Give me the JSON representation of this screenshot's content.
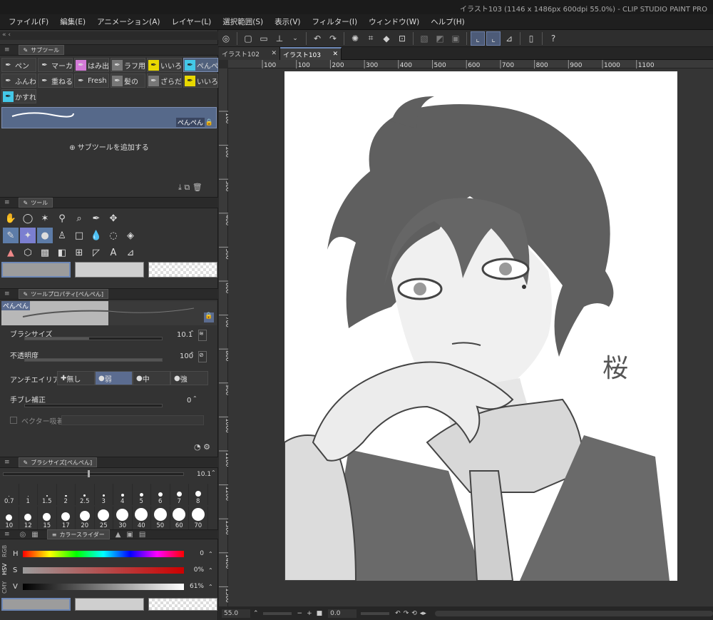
{
  "window": {
    "title": "イラスト103 (1146 x 1486px 600dpi 55.0%) - CLIP STUDIO PAINT PRO"
  },
  "menu": [
    "ファイル(F)",
    "編集(E)",
    "アニメーション(A)",
    "レイヤー(L)",
    "選択範囲(S)",
    "表示(V)",
    "フィルター(I)",
    "ウィンドウ(W)",
    "ヘルプ(H)"
  ],
  "subtool_panel": {
    "title": "サブツール",
    "row1": [
      "ペン",
      "マーカ",
      "はみ出",
      "ラフ用",
      "いいろ",
      "ぺんぺ"
    ],
    "row2": [
      "ふんわ",
      "重ねる",
      "Fresh",
      "髪の",
      "ざらだ",
      "いいろ"
    ],
    "row3": [
      "かすれ"
    ],
    "selected_brush": "ぺんぺん",
    "add_subtool": "サブツールを追加する"
  },
  "tool_panel": {
    "title": "ツール"
  },
  "tool_property": {
    "title": "ツールプロパティ[ぺんぺん]",
    "brush_name": "ぺんぺん",
    "brush_size_label": "ブラシサイズ",
    "brush_size_value": "10.1",
    "opacity_label": "不透明度",
    "opacity_value": "100",
    "antialias_label": "アンチエイリアス",
    "antialias_options": [
      "無し",
      "弱",
      "中",
      "強"
    ],
    "antialias_selected": "弱",
    "stabilization_label": "手ブレ補正",
    "stabilization_value": "0",
    "vector_snap_label": "ベクター吸着"
  },
  "brush_size_panel": {
    "title": "ブラシサイズ[ぺんぺん]",
    "value": "10.1",
    "sizes_row1": [
      "0.7",
      "1",
      "1.5",
      "2",
      "2.5",
      "3",
      "4",
      "5",
      "6",
      "7",
      "8"
    ],
    "sizes_row2": [
      "10",
      "12",
      "15",
      "17",
      "20",
      "25",
      "30",
      "40",
      "50",
      "60",
      "70"
    ]
  },
  "color_slider": {
    "title": "カラースライダー",
    "mode_tabs": [
      "RGB",
      "HSV",
      "CMY"
    ],
    "h_label": "H",
    "h_value": "0",
    "s_label": "S",
    "s_value": "0%",
    "v_label": "V",
    "v_value": "61%"
  },
  "canvas": {
    "tabs": [
      "イラスト102",
      "イラスト103"
    ],
    "active_tab": "イラスト103",
    "ruler_h": [
      "100",
      "100",
      "200",
      "300",
      "400",
      "500",
      "600",
      "700",
      "800",
      "900",
      "1000",
      "1100"
    ],
    "ruler_v": [
      "100",
      "200",
      "300",
      "400",
      "500",
      "600",
      "700",
      "800",
      "900",
      "1000",
      "1100",
      "1200",
      "1300",
      "1400",
      "1500"
    ],
    "zoom": "55.0",
    "rotation": "0.0",
    "signature": "桜"
  },
  "colors": {
    "accent": "#6d87b5",
    "selected": "#56698a",
    "panel": "#333333"
  }
}
